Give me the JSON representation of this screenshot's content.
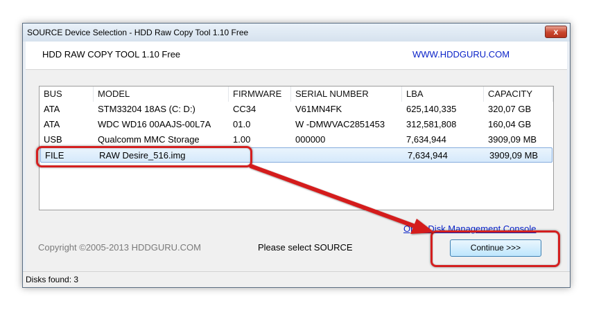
{
  "window": {
    "title": "SOURCE Device Selection - HDD Raw Copy Tool 1.10   Free",
    "close_label": "x"
  },
  "header": {
    "app_name": "HDD RAW COPY TOOL 1.10   Free",
    "site": "WWW.HDDGURU.COM"
  },
  "list": {
    "columns": [
      "BUS",
      "MODEL",
      "FIRMWARE",
      "SERIAL NUMBER",
      "LBA",
      "CAPACITY"
    ],
    "rows": [
      [
        "ATA",
        "STM33204 18AS (C: D:)",
        "CC34",
        "V61MN4FK",
        "625,140,335",
        "320,07 GB"
      ],
      [
        "ATA",
        "WDC WD16 00AAJS-00L7A",
        "01.0",
        "W -DMWVAC2851453",
        "312,581,808",
        "160,04 GB"
      ],
      [
        "USB",
        "Qualcomm MMC Storage",
        "1.00",
        "000000",
        "7,634,944",
        "3909,09 MB"
      ],
      [
        "FILE",
        "RAW Desire_516.img",
        "",
        "",
        "7,634,944",
        "3909,09 MB"
      ]
    ],
    "selected_row": 3
  },
  "footer": {
    "mgmt_link": "Open Disk Management Console",
    "copyright": "Copyright ©2005-2013 HDDGURU.COM",
    "status_message": "Please select SOURCE",
    "continue_label": "Continue >>>"
  },
  "statusbar": {
    "text": "Disks found: 3"
  },
  "annotation": {
    "color": "#d41f1f"
  }
}
